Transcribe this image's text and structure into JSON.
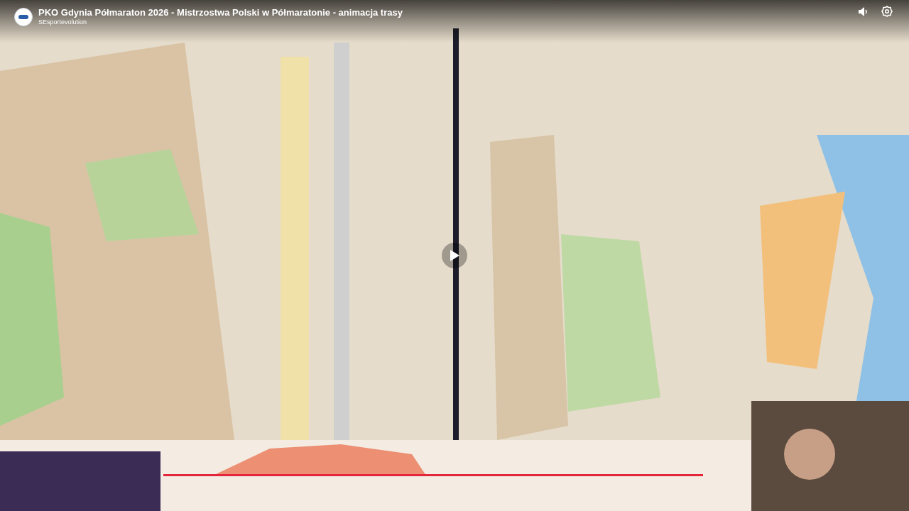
{
  "player": {
    "title": "PKO Gdynia Półmaraton 2026 - Mistrzostwa Polski w Półmaratonie - animacja trasy",
    "channel": "SEsportevolution",
    "paused": true
  }
}
